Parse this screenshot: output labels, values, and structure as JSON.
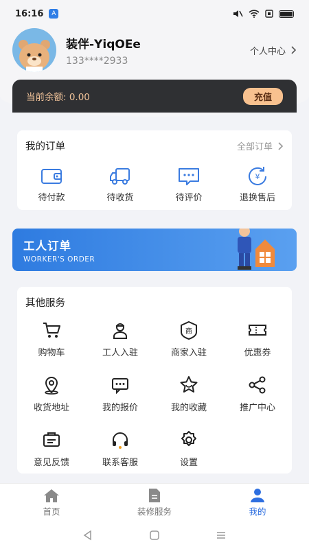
{
  "status_bar": {
    "time": "16:16",
    "app_icon": "app-store-icon"
  },
  "profile": {
    "username": "装伴-YiqOEe",
    "phone": "133****2933",
    "personal_center": "个人中心"
  },
  "balance": {
    "text": "当前余额: 0.00",
    "recharge": "充值"
  },
  "orders": {
    "title": "我的订单",
    "all_link": "全部订单",
    "items": [
      {
        "label": "待付款",
        "icon": "wallet-icon"
      },
      {
        "label": "待收货",
        "icon": "truck-icon"
      },
      {
        "label": "待评价",
        "icon": "comment-icon"
      },
      {
        "label": "退换售后",
        "icon": "refund-icon"
      }
    ]
  },
  "worker_banner": {
    "title": "工人订单",
    "subtitle": "WORKER'S ORDER"
  },
  "services": {
    "title": "其他服务",
    "items": [
      {
        "label": "购物车",
        "icon": "cart-icon"
      },
      {
        "label": "工人入驻",
        "icon": "worker-icon"
      },
      {
        "label": "商家入驻",
        "icon": "shop-icon"
      },
      {
        "label": "优惠券",
        "icon": "coupon-icon"
      },
      {
        "label": "收货地址",
        "icon": "location-icon"
      },
      {
        "label": "我的报价",
        "icon": "quote-icon"
      },
      {
        "label": "我的收藏",
        "icon": "star-icon"
      },
      {
        "label": "推广中心",
        "icon": "share-icon"
      },
      {
        "label": "意见反馈",
        "icon": "feedback-icon"
      },
      {
        "label": "联系客服",
        "icon": "headset-icon"
      },
      {
        "label": "设置",
        "icon": "gear-icon"
      }
    ]
  },
  "tab_bar": {
    "items": [
      {
        "label": "首页",
        "icon": "home-icon"
      },
      {
        "label": "装修服务",
        "icon": "document-icon"
      },
      {
        "label": "我的",
        "icon": "user-icon"
      }
    ],
    "active_index": 2
  },
  "colors": {
    "accent": "#2e6fe0",
    "balance_bg": "#2f3033",
    "recharge_bg": "#f8c18f",
    "gold_text": "#f3c59b"
  }
}
